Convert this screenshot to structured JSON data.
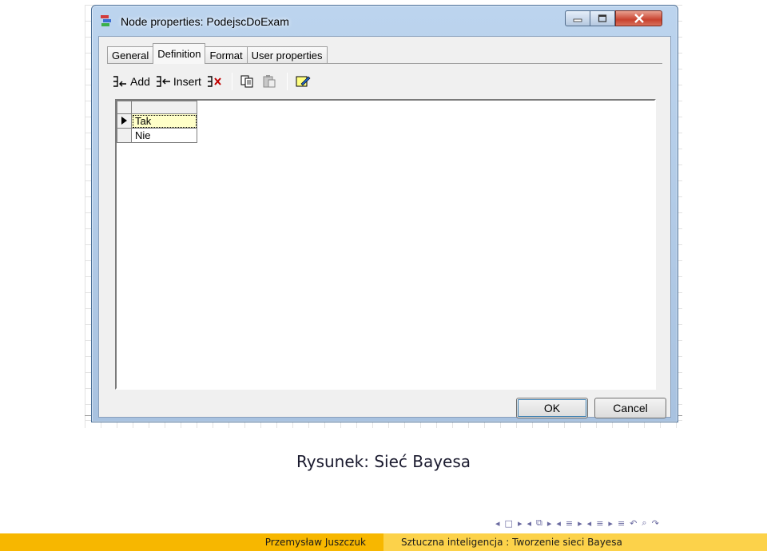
{
  "window": {
    "title": "Node properties: PodejscDoExam"
  },
  "tabs": [
    {
      "label": "General",
      "active": false
    },
    {
      "label": "Definition",
      "active": true
    },
    {
      "label": "Format",
      "active": false
    },
    {
      "label": "User properties",
      "active": false
    }
  ],
  "toolbar": {
    "add_label": "Add",
    "insert_label": "Insert",
    "icons": [
      "add-state-icon",
      "insert-state-icon",
      "delete-state-icon",
      "copy-icon",
      "paste-icon",
      "edit-note-icon"
    ]
  },
  "grid": {
    "rows": [
      {
        "value": "Tak",
        "current": true
      },
      {
        "value": "Nie",
        "current": false
      }
    ]
  },
  "buttons": {
    "ok_label": "OK",
    "cancel_label": "Cancel"
  },
  "caption": "Rysunek: Sieć Bayesa",
  "footer": {
    "author": "Przemysław Juszczuk",
    "title": "Sztuczna inteligencja : Tworzenie sieci Bayesa"
  },
  "colors": {
    "footer_left": "#f7b700",
    "footer_right": "#fcd24a",
    "selected_cell": "#ffffc8",
    "close_button": "#c8422e"
  }
}
